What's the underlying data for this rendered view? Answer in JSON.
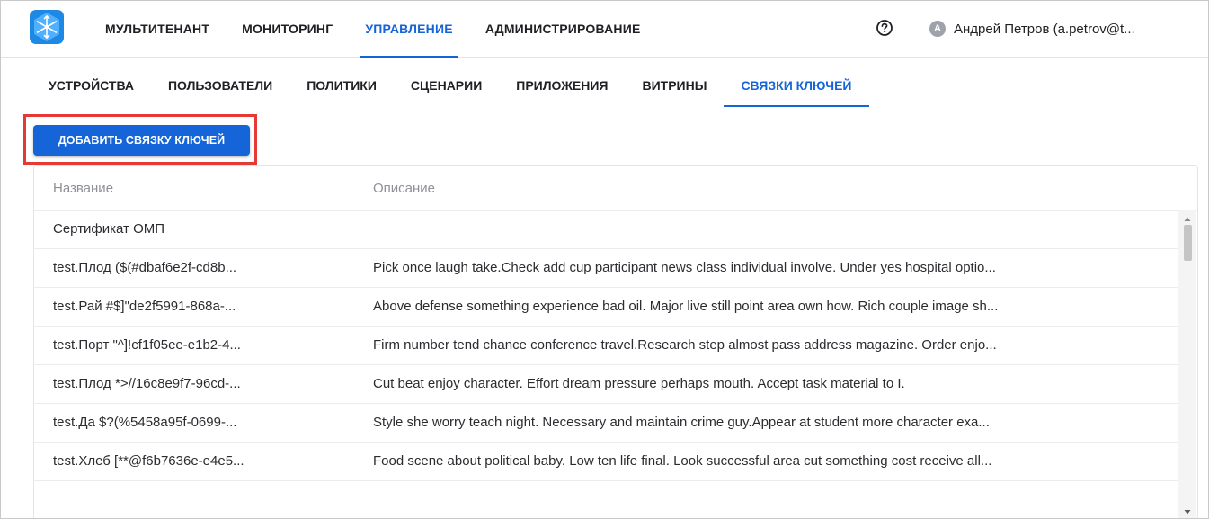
{
  "topnav": {
    "items": [
      {
        "label": "МУЛЬТИТЕНАНТ"
      },
      {
        "label": "МОНИТОРИНГ"
      },
      {
        "label": "УПРАВЛЕНИЕ"
      },
      {
        "label": "АДМИНИСТРИРОВАНИЕ"
      }
    ],
    "active": "УПРАВЛЕНИЕ"
  },
  "user": {
    "avatar_letter": "A",
    "name": "Андрей Петров (a.petrov@t..."
  },
  "subnav": {
    "items": [
      {
        "label": "УСТРОЙСТВА"
      },
      {
        "label": "ПОЛЬЗОВАТЕЛИ"
      },
      {
        "label": "ПОЛИТИКИ"
      },
      {
        "label": "СЦЕНАРИИ"
      },
      {
        "label": "ПРИЛОЖЕНИЯ"
      },
      {
        "label": "ВИТРИНЫ"
      },
      {
        "label": "СВЯЗКИ КЛЮЧЕЙ"
      }
    ],
    "active": "СВЯЗКИ КЛЮЧЕЙ"
  },
  "toolbar": {
    "add_label": "ДОБАВИТЬ СВЯЗКУ КЛЮЧЕЙ"
  },
  "table": {
    "columns": {
      "name": "Название",
      "description": "Описание"
    },
    "rows": [
      {
        "name": "Сертификат ОМП",
        "description": ""
      },
      {
        "name": "test.Плод ($(#dbaf6e2f-cd8b...",
        "description": "Pick once laugh take.Check add cup participant news class individual involve. Under yes hospital optio..."
      },
      {
        "name": "test.Рай #$]\"de2f5991-868a-...",
        "description": "Above defense something experience bad oil. Major live still point area own how. Rich couple image sh..."
      },
      {
        "name": "test.Порт \"^]!cf1f05ee-e1b2-4...",
        "description": "Firm number tend chance conference travel.Research step almost pass address magazine. Order enjo..."
      },
      {
        "name": "test.Плод *>//16c8e9f7-96cd-...",
        "description": "Cut beat enjoy character. Effort dream pressure perhaps mouth. Accept task material to I."
      },
      {
        "name": "test.Да $?(%5458a95f-0699-...",
        "description": "Style she worry teach night. Necessary and maintain crime guy.Appear at student more character exa..."
      },
      {
        "name": "test.Хлеб [**@f6b7636e-e4e5...",
        "description": "Food scene about political baby. Low ten life final. Look successful area cut something cost receive all..."
      }
    ]
  },
  "colors": {
    "accent": "#1565d8",
    "highlight": "#e53935",
    "logo": "#1e88e5"
  },
  "icons": {
    "logo": "snowflake-logo",
    "help": "help-circle-icon",
    "scroll_up": "arrow-up-icon",
    "scroll_down": "arrow-down-icon"
  }
}
